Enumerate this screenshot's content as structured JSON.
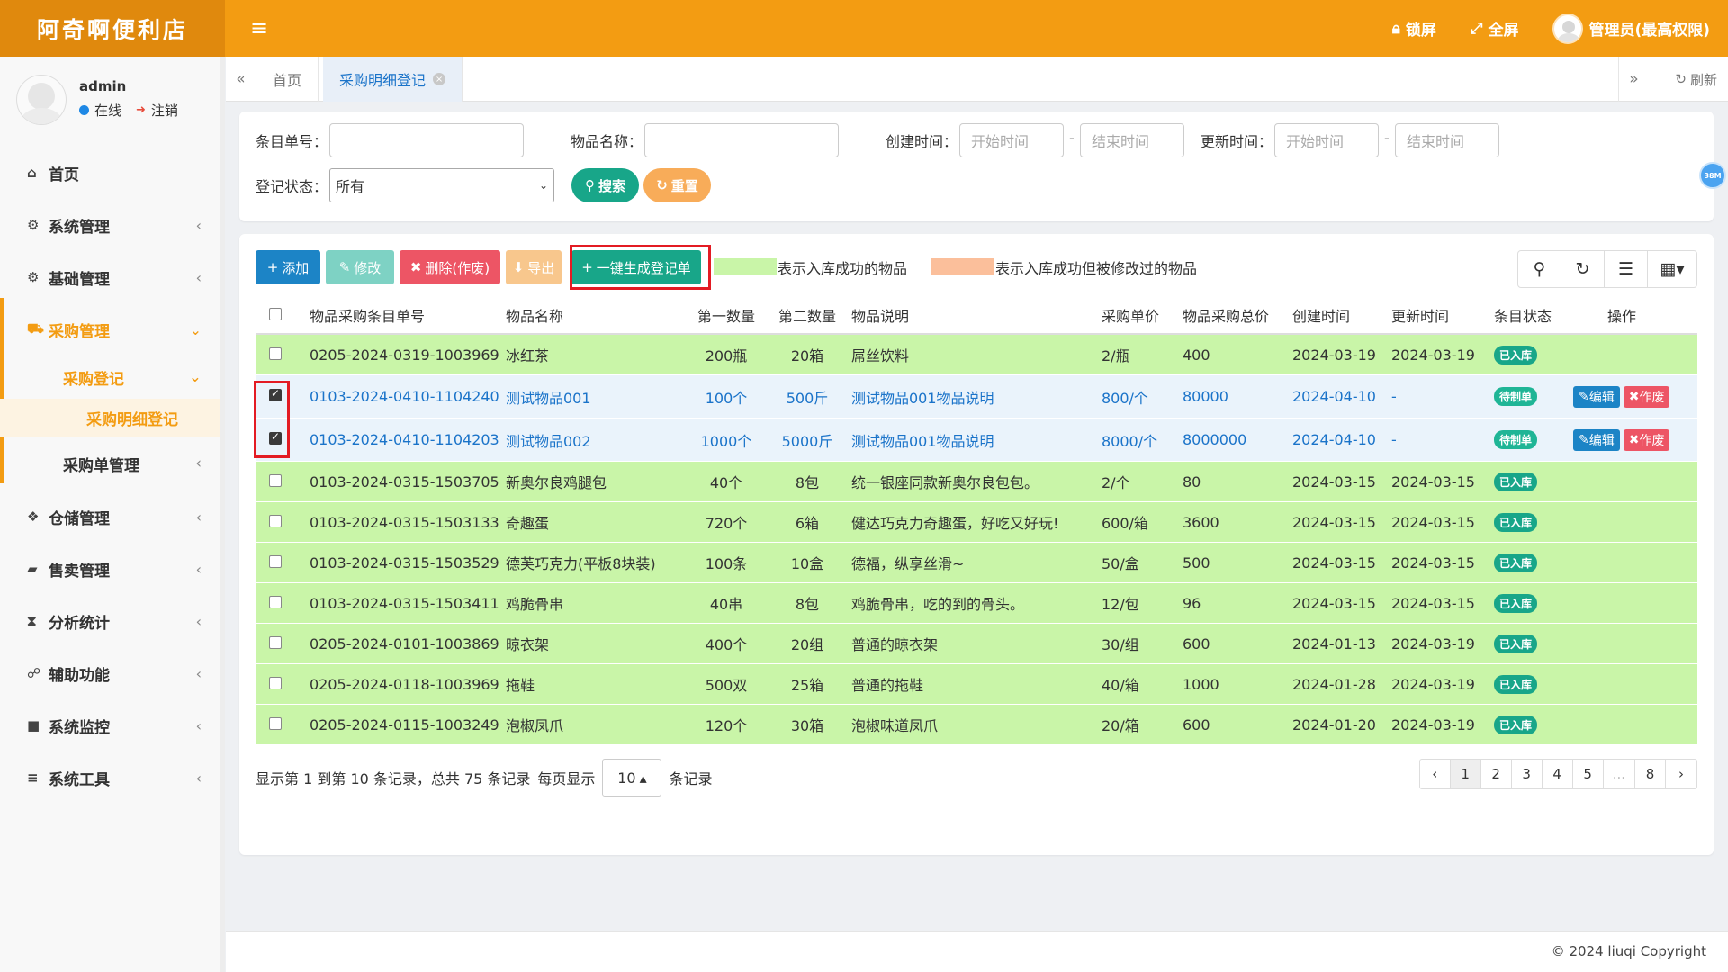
{
  "app": {
    "title": "阿奇啊便利店"
  },
  "topbar": {
    "lock_label": "锁屏",
    "fullscreen_label": "全屏",
    "user_label": "管理员(最高权限)"
  },
  "user": {
    "name": "admin",
    "status": "在线",
    "logout": "注销"
  },
  "sidebar": {
    "items": [
      {
        "label": "首页",
        "icon": "home-icon"
      },
      {
        "label": "系统管理",
        "icon": "gear-icon"
      },
      {
        "label": "基础管理",
        "icon": "cogs-icon"
      },
      {
        "label": "采购管理",
        "icon": "truck-icon"
      },
      {
        "label": "采购登记"
      },
      {
        "label": "采购明细登记"
      },
      {
        "label": "采购单管理"
      },
      {
        "label": "仓储管理",
        "icon": "cubes-icon"
      },
      {
        "label": "售卖管理",
        "icon": "briefcase-icon"
      },
      {
        "label": "分析统计",
        "icon": "hourglass-icon"
      },
      {
        "label": "辅助功能",
        "icon": "handshake-icon"
      },
      {
        "label": "系统监控",
        "icon": "video-icon"
      },
      {
        "label": "系统工具",
        "icon": "bars-icon"
      }
    ]
  },
  "tabs": {
    "home": "首页",
    "current": "采购明细登记",
    "refresh": "刷新"
  },
  "search": {
    "item_no_label": "条目单号：",
    "item_name_label": "物品名称：",
    "created_label": "创建时间：",
    "updated_label": "更新时间：",
    "start_placeholder": "开始时间",
    "end_placeholder": "结束时间",
    "dash": "-",
    "status_label": "登记状态：",
    "status_value": "所有",
    "search_button": "搜索",
    "reset_button": "重置",
    "side_badge": "38M"
  },
  "toolbar": {
    "add": "添加",
    "edit": "修改",
    "delete": "删除(作废)",
    "export": "导出",
    "generate": "一键生成登记单",
    "legend_green": "表示入库成功的物品",
    "legend_orange": "表示入库成功但被修改过的物品",
    "legend_green_color": "#c9f5a8",
    "legend_orange_color": "#fbbf9b"
  },
  "table": {
    "headers": [
      "物品采购条目单号",
      "物品名称",
      "第一数量",
      "第二数量",
      "物品说明",
      "采购单价",
      "物品采购总价",
      "创建时间",
      "更新时间",
      "条目状态",
      "操作"
    ],
    "rows": [
      {
        "no": "0205-2024-0319-1003969",
        "name": "冰红茶",
        "q1": "200瓶",
        "q2": "20箱",
        "desc": "屌丝饮料",
        "price": "2/瓶",
        "total": "400",
        "created": "2024-03-19",
        "updated": "2024-03-19",
        "status": "已入库"
      },
      {
        "no": "0103-2024-0410-1104240",
        "name": "测试物品001",
        "q1": "100个",
        "q2": "500斤",
        "desc": "测试物品001物品说明",
        "price": "800/个",
        "total": "80000",
        "created": "2024-04-10",
        "updated": "-",
        "status": "待制单",
        "edit": "编辑",
        "void": "作废"
      },
      {
        "no": "0103-2024-0410-1104203",
        "name": "测试物品002",
        "q1": "1000个",
        "q2": "5000斤",
        "desc": "测试物品001物品说明",
        "price": "8000/个",
        "total": "8000000",
        "created": "2024-04-10",
        "updated": "-",
        "status": "待制单",
        "edit": "编辑",
        "void": "作废"
      },
      {
        "no": "0103-2024-0315-1503705",
        "name": "新奥尔良鸡腿包",
        "q1": "40个",
        "q2": "8包",
        "desc": "统一银座同款新奥尔良包包。",
        "price": "2/个",
        "total": "80",
        "created": "2024-03-15",
        "updated": "2024-03-15",
        "status": "已入库"
      },
      {
        "no": "0103-2024-0315-1503133",
        "name": "奇趣蛋",
        "q1": "720个",
        "q2": "6箱",
        "desc": "健达巧克力奇趣蛋，好吃又好玩!",
        "price": "600/箱",
        "total": "3600",
        "created": "2024-03-15",
        "updated": "2024-03-15",
        "status": "已入库"
      },
      {
        "no": "0103-2024-0315-1503529",
        "name": "德芙巧克力(平板8块装)",
        "q1": "100条",
        "q2": "10盒",
        "desc": "德福，纵享丝滑~",
        "price": "50/盒",
        "total": "500",
        "created": "2024-03-15",
        "updated": "2024-03-15",
        "status": "已入库"
      },
      {
        "no": "0103-2024-0315-1503411",
        "name": "鸡脆骨串",
        "q1": "40串",
        "q2": "8包",
        "desc": "鸡脆骨串，吃的到的骨头。",
        "price": "12/包",
        "total": "96",
        "created": "2024-03-15",
        "updated": "2024-03-15",
        "status": "已入库"
      },
      {
        "no": "0205-2024-0101-1003869",
        "name": "晾衣架",
        "q1": "400个",
        "q2": "20组",
        "desc": "普通的晾衣架",
        "price": "30/组",
        "total": "600",
        "created": "2024-01-13",
        "updated": "2024-03-19",
        "status": "已入库"
      },
      {
        "no": "0205-2024-0118-1003969",
        "name": "拖鞋",
        "q1": "500双",
        "q2": "25箱",
        "desc": "普通的拖鞋",
        "price": "40/箱",
        "total": "1000",
        "created": "2024-01-28",
        "updated": "2024-03-19",
        "status": "已入库"
      },
      {
        "no": "0205-2024-0115-1003249",
        "name": "泡椒凤爪",
        "q1": "120个",
        "q2": "30箱",
        "desc": "泡椒味道凤爪",
        "price": "20/箱",
        "total": "600",
        "created": "2024-01-20",
        "updated": "2024-03-19",
        "status": "已入库"
      }
    ]
  },
  "pager": {
    "info": "显示第 1 到第 10 条记录，总共 75 条记录",
    "per_page_label": "每页显示",
    "page_size": "10",
    "records_label": "条记录",
    "pages": [
      "‹",
      "1",
      "2",
      "3",
      "4",
      "5",
      "...",
      "8",
      "›"
    ]
  },
  "footer": {
    "copyright": "© 2024 liuqi Copyright"
  }
}
